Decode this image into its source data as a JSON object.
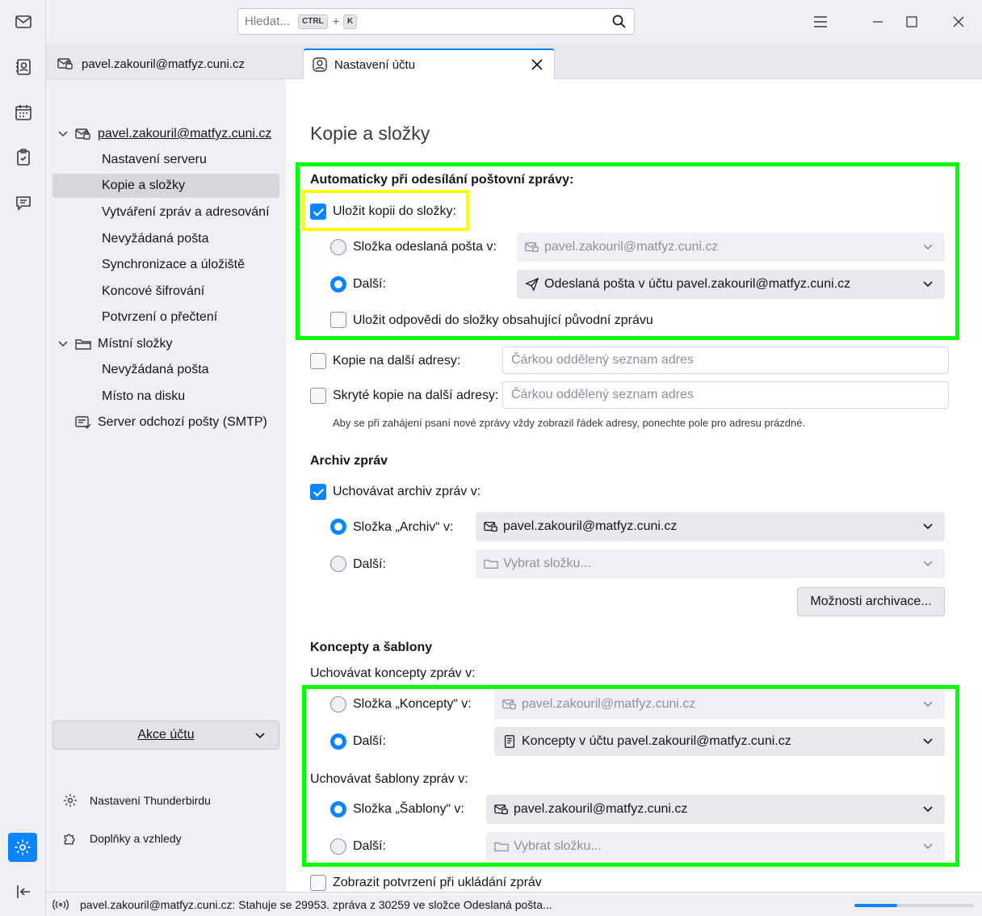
{
  "window": {
    "search_placeholder": "Hledat...",
    "shortcut_ctrl": "CTRL",
    "shortcut_plus": "+",
    "shortcut_key": "K"
  },
  "tabs": [
    {
      "label": "pavel.zakouril@matfyz.cuni.cz",
      "icon": "mail-account-icon"
    },
    {
      "label": "Nastavení účtu",
      "icon": "account-settings-icon"
    }
  ],
  "sidebar": {
    "account": "pavel.zakouril@matfyz.cuni.cz",
    "items": [
      "Nastavení serveru",
      "Kopie a složky",
      "Vytváření zpráv a adresování",
      "Nevyžádaná pošta",
      "Synchronizace a úložiště",
      "Koncové šifrování",
      "Potvrzení o přečtení"
    ],
    "local_folders": "Místní složky",
    "local_items": [
      "Nevyžádaná pošta",
      "Místo na disku"
    ],
    "smtp": "Server odchozí pošty (SMTP)",
    "account_actions": "Akce účtu",
    "tb_settings": "Nastavení Thunderbirdu",
    "addons": "Doplňky a vzhledy"
  },
  "main": {
    "title": "Kopie a složky",
    "sending": {
      "heading": "Automaticky při odesílání poštovní zprávy:",
      "save_copy": "Uložit kopii do složky:",
      "save_copy_checked": true,
      "sent_folder_in": "Složka odeslaná pošta v:",
      "sent_folder_value": "pavel.zakouril@matfyz.cuni.cz",
      "other": "Další:",
      "other_value": "Odeslaná pošta v účtu pavel.zakouril@matfyz.cuni.cz",
      "replies_in_folder": "Uložit odpovědi do složky obsahující původní zprávu",
      "cc_label": "Kopie na další adresy:",
      "cc_placeholder": "Čárkou oddělený seznam adres",
      "bcc_label": "Skryté kopie na další adresy:",
      "bcc_placeholder": "Čárkou oddělený seznam adres",
      "note": "Aby se při zahájení psaní nové zprávy vždy zobrazil řádek adresy, ponechte pole pro adresu prázdné."
    },
    "archive": {
      "heading": "Archiv zpráv",
      "keep": "Uchovávat archiv zpráv v:",
      "keep_checked": true,
      "folder_in": "Složka „Archiv“ v:",
      "folder_value": "pavel.zakouril@matfyz.cuni.cz",
      "other": "Další:",
      "other_value": "Vybrat složku...",
      "options_button": "Možnosti archivace..."
    },
    "drafts": {
      "heading": "Koncepty a šablony",
      "keep_drafts": "Uchovávat koncepty zpráv v:",
      "drafts_in": "Složka „Koncepty“ v:",
      "drafts_in_value": "pavel.zakouril@matfyz.cuni.cz",
      "drafts_other": "Další:",
      "drafts_other_value": "Koncepty v účtu pavel.zakouril@matfyz.cuni.cz",
      "keep_templates": "Uchovávat šablony zpráv v:",
      "templates_in": "Složka „Šablony“ v:",
      "templates_in_value": "pavel.zakouril@matfyz.cuni.cz",
      "templates_other": "Další:",
      "templates_other_value": "Vybrat složku...",
      "confirm_save": "Zobrazit potvrzení při ukládání zpráv"
    }
  },
  "status": {
    "text": "pavel.zakouril@matfyz.cuni.cz: Stahuje se 29953. zpráva z 30259 ve složce Odeslaná pošta...",
    "progress": 0.36
  },
  "colors": {
    "accent": "#0a84ff",
    "highlight_green": "#00ff00",
    "highlight_yellow": "#ffff00"
  }
}
